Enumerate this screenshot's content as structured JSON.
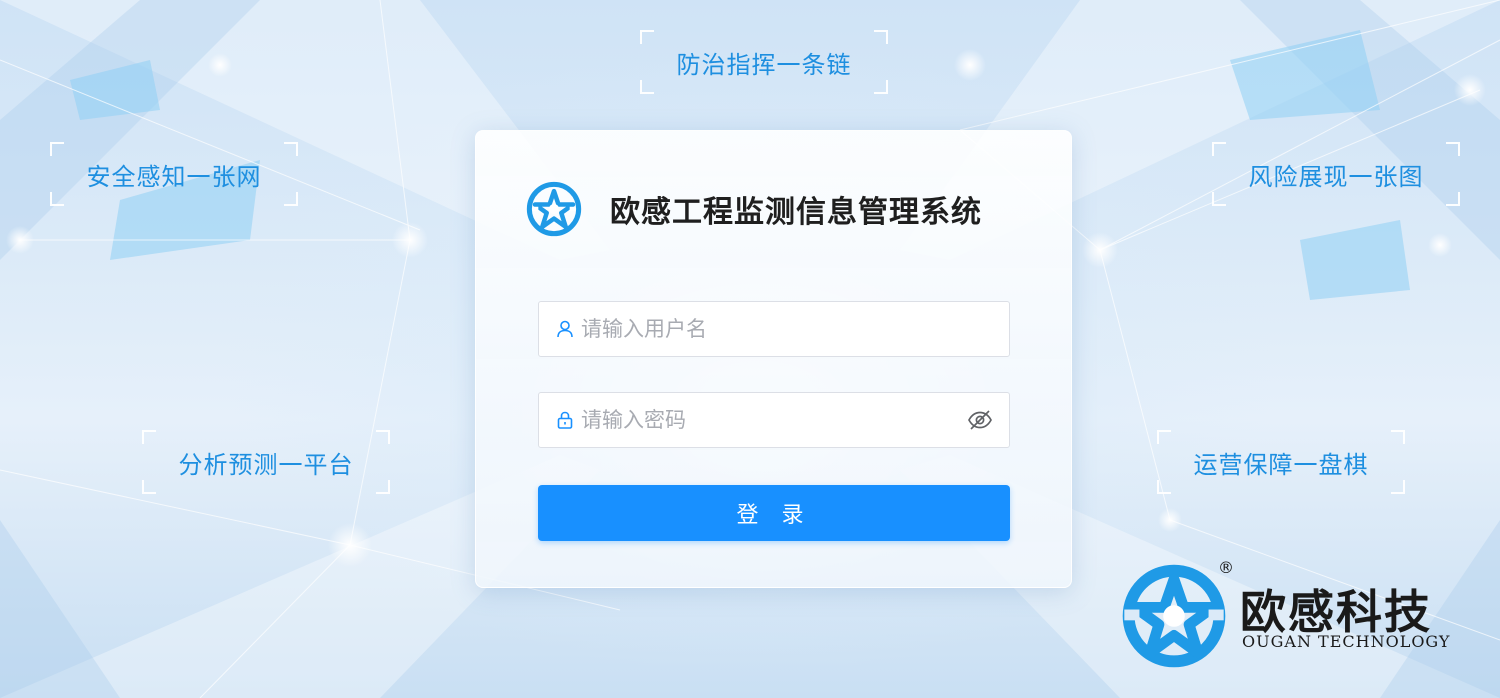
{
  "slogans": {
    "top": "防治指挥一条链",
    "left_upper": "安全感知一张网",
    "right_upper": "风险展现一张图",
    "left_lower": "分析预测一平台",
    "right_lower": "运营保障一盘棋"
  },
  "login": {
    "system_title": "欧感工程监测信息管理系统",
    "username_placeholder": "请输入用户名",
    "password_placeholder": "请输入密码",
    "submit_label": "登 录",
    "icons": {
      "username": "user-icon",
      "password": "lock-icon",
      "toggle": "eye-off-icon"
    }
  },
  "brand": {
    "name_cn": "欧感科技",
    "name_en": "OUGAN TECHNOLOGY",
    "registered": "®"
  },
  "colors": {
    "accent": "#1890ff",
    "slogan": "#1e8fe0",
    "logo_blue": "#1f9ae6"
  }
}
